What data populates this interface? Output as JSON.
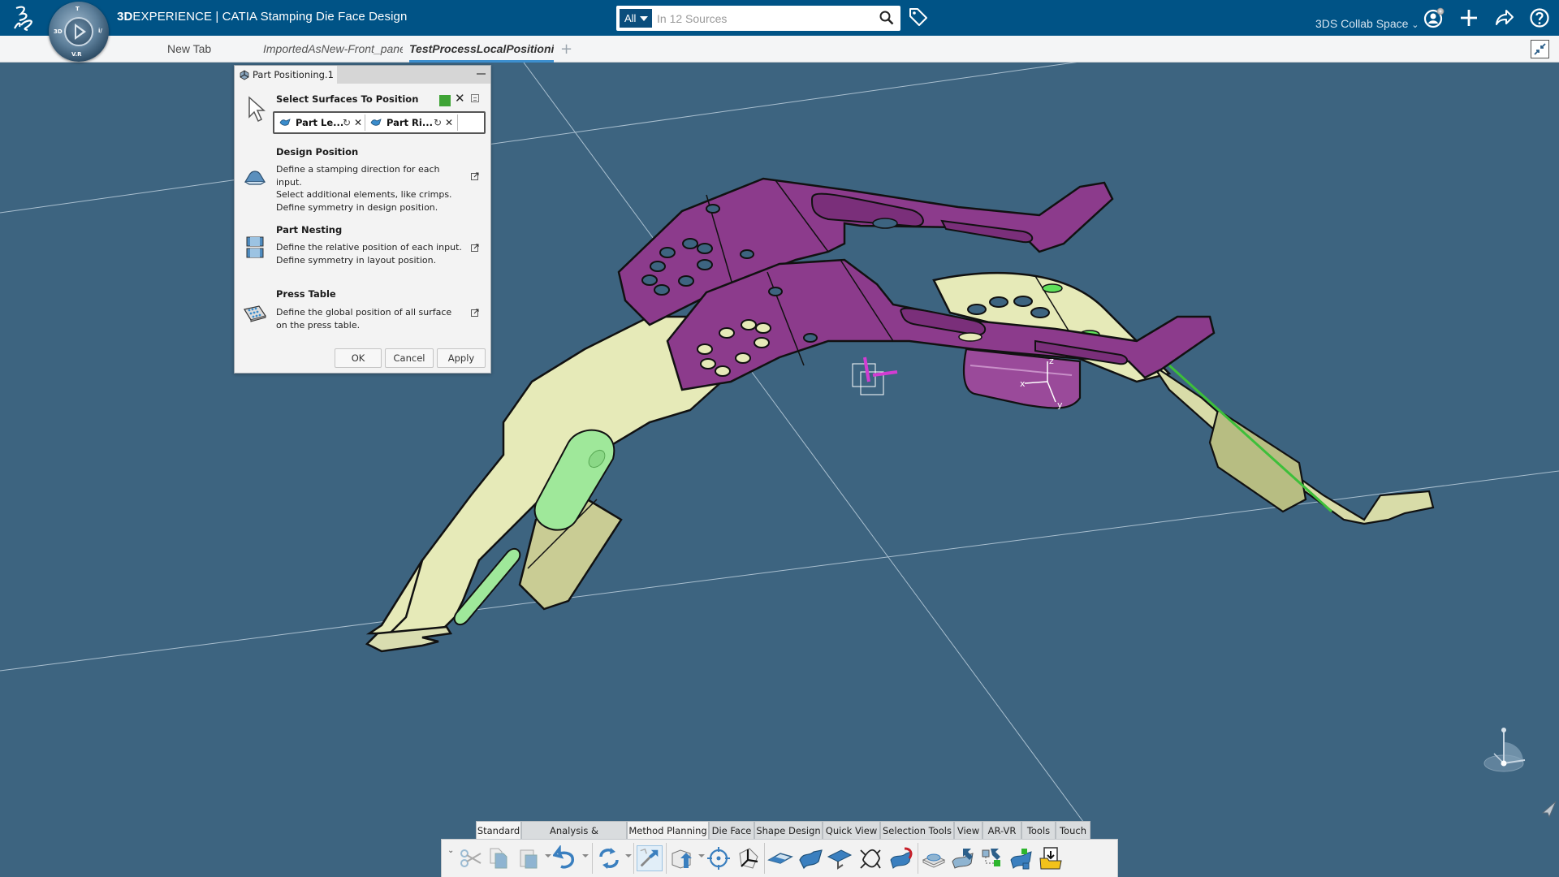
{
  "header": {
    "brand_bold": "3D",
    "brand_rest": "EXPERIENCE | CATIA Stamping Die Face Design",
    "compass_labels": {
      "top": "T",
      "left": "3D",
      "right": "i/",
      "bottom": "V.R"
    },
    "search": {
      "filter_label": "All",
      "placeholder": "In 12 Sources",
      "value": ""
    },
    "collab_space": "3DS Collab Space"
  },
  "tabs": [
    {
      "label": "New Tab",
      "active": false
    },
    {
      "label": "ImportedAsNew-Front_panel",
      "active": false
    },
    {
      "label": "TestProcessLocalPositioning",
      "active": true
    }
  ],
  "dialog": {
    "title": "Part Positioning.1",
    "select_title": "Select Surfaces To Position",
    "selections": [
      {
        "label": "Part Le..."
      },
      {
        "label": "Part Ri..."
      }
    ],
    "sections": [
      {
        "title": "Design Position",
        "lines": [
          "Define a stamping direction for each input.",
          "Select additional elements, like crimps.",
          "Define symmetry in design position."
        ]
      },
      {
        "title": "Part Nesting",
        "lines": [
          "Define the relative position of each input.",
          "Define symmetry in layout position."
        ]
      },
      {
        "title": "Press Table",
        "lines": [
          "Define the global position of all surface",
          "on the press table."
        ]
      }
    ],
    "buttons": {
      "ok": "OK",
      "cancel": "Cancel",
      "apply": "Apply"
    },
    "status_color": "#3fa436"
  },
  "action_bar": {
    "tabs": [
      {
        "label": "Standard"
      },
      {
        "label": "Analysis & Preparation"
      },
      {
        "label": "Method Planning"
      },
      {
        "label": "Die Face"
      },
      {
        "label": "Shape Design"
      },
      {
        "label": "Quick View"
      },
      {
        "label": "Selection Tools"
      },
      {
        "label": "View"
      },
      {
        "label": "AR-VR"
      },
      {
        "label": "Tools"
      },
      {
        "label": "Touch"
      }
    ],
    "active_tab": "Standard",
    "tools": [
      "cut-icon",
      "copy-icon",
      "paste-icon",
      "undo-icon",
      "update-icon",
      "part-positioning-icon",
      "import-part-icon",
      "target-icon",
      "axis-system-icon",
      "plane-surface-icon",
      "surface-icon",
      "die-face-icon",
      "curve-icon",
      "flip-surface-icon",
      "press-table-icon",
      "surface-transfer-icon",
      "hierarchy-icon",
      "connect-icon",
      "folder-import-icon"
    ]
  },
  "scene": {
    "axis_labels": {
      "x": "x",
      "y": "y",
      "z": "z"
    },
    "part_colors": {
      "left_part": "#e6eab8",
      "right_part": "#8c3b8c",
      "highlight": "#9fe89a",
      "background": "#3d6480"
    }
  }
}
